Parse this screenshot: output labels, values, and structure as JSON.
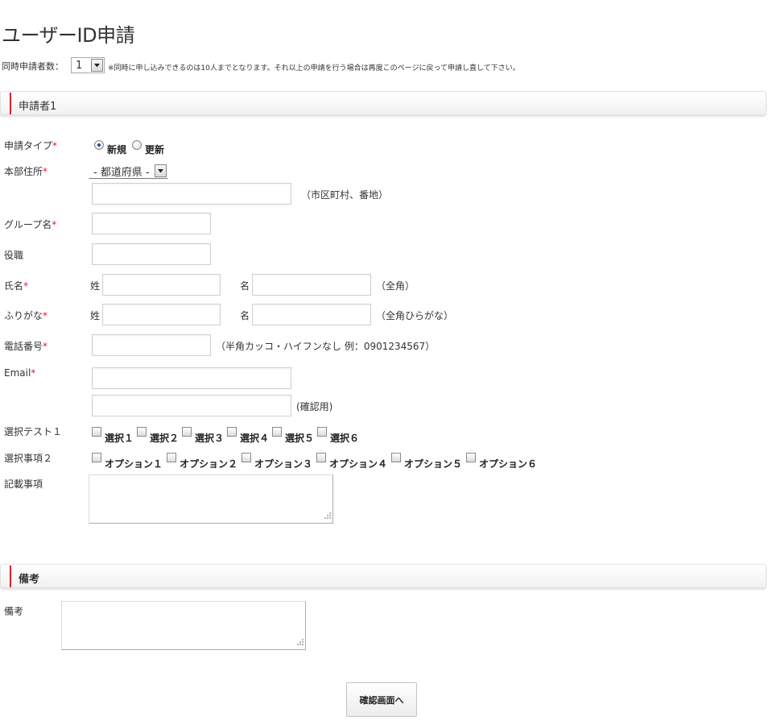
{
  "page": {
    "title": "ユーザーID申請"
  },
  "applicant_count": {
    "label": "同時申請者数：",
    "value": "1",
    "note": "※同時に申し込みできるのは10人までとなります。それ以上の申請を行う場合は再度このページに戻って申請し直して下さい。"
  },
  "section1": {
    "title": "申請者1"
  },
  "form": {
    "required_mark": "*",
    "apply_type": {
      "label": "申請タイプ",
      "options": [
        {
          "label": "新規",
          "checked": true
        },
        {
          "label": "更新",
          "checked": false
        }
      ]
    },
    "address": {
      "label": "本部住所",
      "prefecture_value": "- 都道府県 -",
      "detail_hint": "（市区町村、番地）"
    },
    "group_name": {
      "label": "グループ名"
    },
    "position": {
      "label": "役職"
    },
    "name": {
      "label": "氏名",
      "last_label": "姓",
      "first_label": "名",
      "hint": "（全角）"
    },
    "furigana": {
      "label": "ふりがな",
      "last_label": "姓",
      "first_label": "名",
      "hint": "（全角ひらがな）"
    },
    "phone": {
      "label": "電話番号",
      "hint": "（半角カッコ・ハイフンなし  例：0901234567）"
    },
    "email": {
      "label": "Email",
      "confirm_hint": "(確認用)"
    },
    "test1": {
      "label": "選択テスト１",
      "options": [
        "選択１",
        "選択２",
        "選択３",
        "選択４",
        "選択５",
        "選択６"
      ]
    },
    "test2": {
      "label": "選択事項２",
      "options": [
        "オプション１",
        "オプション２",
        "オプション３",
        "オプション４",
        "オプション５",
        "オプション６"
      ]
    },
    "notes_field": {
      "label": "記載事項"
    }
  },
  "section2": {
    "title": "備考"
  },
  "remarks": {
    "label": "備考"
  },
  "actions": {
    "confirm_label": "確認画面へ"
  },
  "icons": {
    "select_arrow": "triangle-down-icon",
    "textarea_grip": "resize-grip-icon"
  }
}
